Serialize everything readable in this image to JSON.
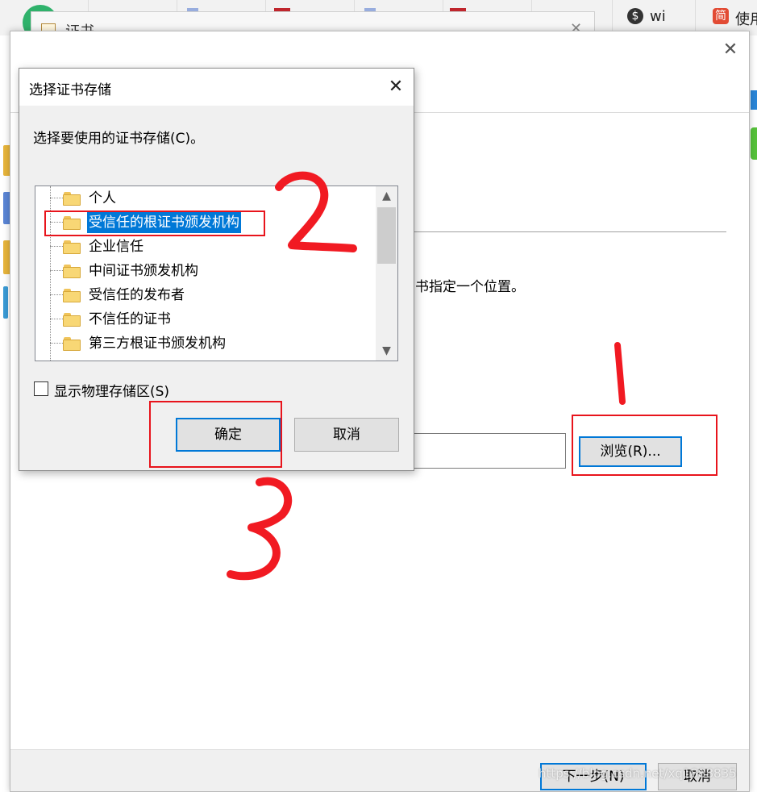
{
  "background": {
    "cert_window_title": "证书",
    "taskbar_text_1": "wi",
    "taskbar_icon_2": "简",
    "taskbar_text_2": "使用"
  },
  "wizard": {
    "description_fragment": "书指定一个位置。",
    "browse_label": "浏览(R)...",
    "next_label": "下一步(N)",
    "cancel_label": "取消"
  },
  "dialog": {
    "title": "选择证书存储",
    "prompt": "选择要使用的证书存储(C)。",
    "stores": [
      {
        "label": "个人",
        "selected": false
      },
      {
        "label": "受信任的根证书颁发机构",
        "selected": true
      },
      {
        "label": "企业信任",
        "selected": false
      },
      {
        "label": "中间证书颁发机构",
        "selected": false
      },
      {
        "label": "受信任的发布者",
        "selected": false
      },
      {
        "label": "不信任的证书",
        "selected": false
      },
      {
        "label": "第三方根证书颁发机构",
        "selected": false
      }
    ],
    "show_physical_label": "显示物理存储区(S)",
    "show_physical_checked": false,
    "ok_label": "确定",
    "cancel_label": "取消"
  },
  "annotations": {
    "step_1": "1",
    "step_2": "2",
    "step_3": "3",
    "color": "#e8141c"
  },
  "watermark": "https://blog.csdn.net/xq1888835"
}
